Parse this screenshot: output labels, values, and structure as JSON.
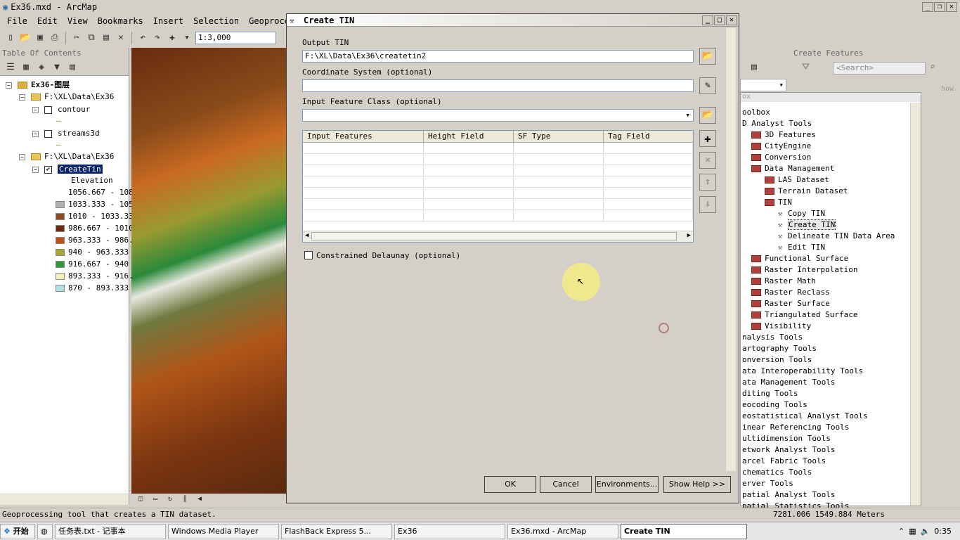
{
  "app": {
    "title": "Ex36.mxd - ArcMap",
    "icon": "arcmap-globe-icon"
  },
  "menu": [
    "File",
    "Edit",
    "View",
    "Bookmarks",
    "Insert",
    "Selection",
    "Geoprocessing"
  ],
  "toolbar": {
    "scale": "1:3,000"
  },
  "toc": {
    "title": "Table Of Contents",
    "root": "Ex36-图层",
    "group1": "F:\\XL\\Data\\Ex36",
    "layer_contour": "contour",
    "layer_streams": "streams3d",
    "group2": "F:\\XL\\Data\\Ex36",
    "layer_tin": "CreateTin",
    "legend_title": "Elevation",
    "legend": [
      {
        "label": "1056.667 - 108",
        "color": "#ffffff"
      },
      {
        "label": "1033.333 - 105",
        "color": "#b0b0b0"
      },
      {
        "label": "1010 - 1033.33",
        "color": "#8a4b20"
      },
      {
        "label": "986.667 - 1010",
        "color": "#6b2a0f"
      },
      {
        "label": "963.333 - 986.",
        "color": "#c05018"
      },
      {
        "label": "940 - 963.333",
        "color": "#a8a830"
      },
      {
        "label": "916.667 - 940",
        "color": "#2a9a3a"
      },
      {
        "label": "893.333 - 916.",
        "color": "#f0f0b8"
      },
      {
        "label": "870 - 893.333",
        "color": "#b0e0e0"
      }
    ]
  },
  "dialog": {
    "title": "Create TIN",
    "output_label": "Output TIN",
    "output_value": "F:\\XL\\Data\\Ex36\\createtin2",
    "coord_label": "Coordinate System (optional)",
    "coord_value": "",
    "input_fc_label": "Input Feature Class (optional)",
    "columns": [
      "Input Features",
      "Height Field",
      "SF Type",
      "Tag Field"
    ],
    "constrained_label": "Constrained Delaunay (optional)",
    "constrained_checked": false,
    "ok": "OK",
    "cancel": "Cancel",
    "environments": "Environments...",
    "show_help": "Show Help >>"
  },
  "create_features": {
    "title": "Create Features",
    "search_placeholder": "<Search>",
    "hint": "how."
  },
  "toolbox": {
    "title": "ox",
    "items": [
      {
        "label": "oolbox",
        "indent": 0,
        "kind": "text"
      },
      {
        "label": "D Analyst Tools",
        "indent": 0,
        "kind": "text"
      },
      {
        "label": "3D Features",
        "indent": 1,
        "kind": "toolset"
      },
      {
        "label": "CityEngine",
        "indent": 1,
        "kind": "toolset"
      },
      {
        "label": "Conversion",
        "indent": 1,
        "kind": "toolset"
      },
      {
        "label": "Data Management",
        "indent": 1,
        "kind": "toolset"
      },
      {
        "label": "LAS Dataset",
        "indent": 2,
        "kind": "toolset"
      },
      {
        "label": "Terrain Dataset",
        "indent": 2,
        "kind": "toolset"
      },
      {
        "label": "TIN",
        "indent": 2,
        "kind": "toolset"
      },
      {
        "label": "Copy TIN",
        "indent": 3,
        "kind": "tool"
      },
      {
        "label": "Create TIN",
        "indent": 3,
        "kind": "tool",
        "selected": true
      },
      {
        "label": "Delineate TIN Data Area",
        "indent": 3,
        "kind": "tool"
      },
      {
        "label": "Edit TIN",
        "indent": 3,
        "kind": "tool"
      },
      {
        "label": "Functional Surface",
        "indent": 1,
        "kind": "toolset"
      },
      {
        "label": "Raster Interpolation",
        "indent": 1,
        "kind": "toolset"
      },
      {
        "label": "Raster Math",
        "indent": 1,
        "kind": "toolset"
      },
      {
        "label": "Raster Reclass",
        "indent": 1,
        "kind": "toolset"
      },
      {
        "label": "Raster Surface",
        "indent": 1,
        "kind": "toolset"
      },
      {
        "label": "Triangulated Surface",
        "indent": 1,
        "kind": "toolset"
      },
      {
        "label": "Visibility",
        "indent": 1,
        "kind": "toolset"
      },
      {
        "label": "nalysis Tools",
        "indent": 0,
        "kind": "text"
      },
      {
        "label": "artography Tools",
        "indent": 0,
        "kind": "text"
      },
      {
        "label": "onversion Tools",
        "indent": 0,
        "kind": "text"
      },
      {
        "label": "ata Interoperability Tools",
        "indent": 0,
        "kind": "text"
      },
      {
        "label": "ata Management Tools",
        "indent": 0,
        "kind": "text"
      },
      {
        "label": "diting Tools",
        "indent": 0,
        "kind": "text"
      },
      {
        "label": "eocoding Tools",
        "indent": 0,
        "kind": "text"
      },
      {
        "label": "eostatistical Analyst Tools",
        "indent": 0,
        "kind": "text"
      },
      {
        "label": "inear Referencing Tools",
        "indent": 0,
        "kind": "text"
      },
      {
        "label": "ultidimension Tools",
        "indent": 0,
        "kind": "text"
      },
      {
        "label": "etwork Analyst Tools",
        "indent": 0,
        "kind": "text"
      },
      {
        "label": "arcel Fabric Tools",
        "indent": 0,
        "kind": "text"
      },
      {
        "label": "chematics Tools",
        "indent": 0,
        "kind": "text"
      },
      {
        "label": "erver Tools",
        "indent": 0,
        "kind": "text"
      },
      {
        "label": "patial Analyst Tools",
        "indent": 0,
        "kind": "text"
      },
      {
        "label": "patial Statistics Tools",
        "indent": 0,
        "kind": "text"
      }
    ]
  },
  "status": {
    "message": "Geoprocessing tool that creates a TIN dataset.",
    "coords": "7281.006  1549.884 Meters"
  },
  "taskbar": {
    "start": "开始",
    "items": [
      "任务表.txt - 记事本",
      "Windows Media Player",
      "FlashBack Express 5...",
      "Ex36",
      "Ex36.mxd - ArcMap",
      "Create TIN"
    ],
    "clock": "0:35"
  }
}
